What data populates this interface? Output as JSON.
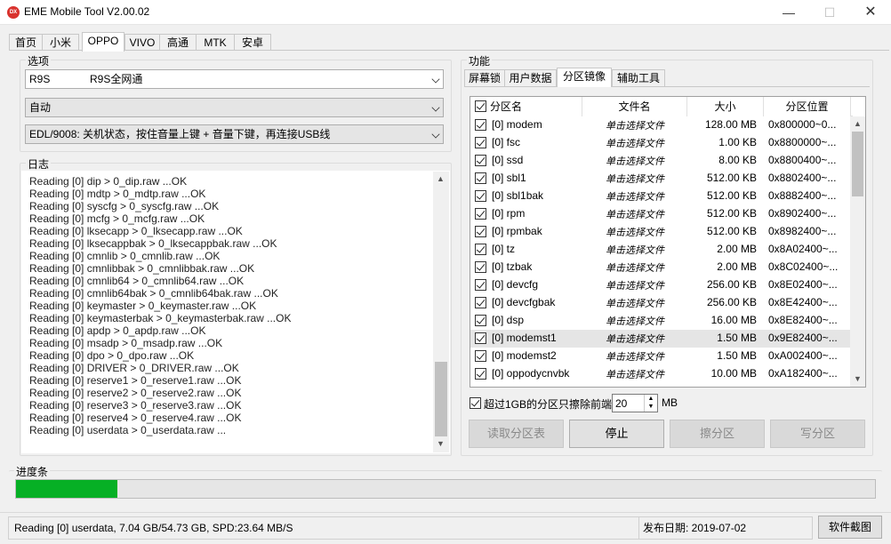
{
  "window": {
    "title": "EME Mobile Tool V2.00.02",
    "icon_text": "DX"
  },
  "top_tabs": [
    "首页",
    "小米",
    "OPPO",
    "VIVO",
    "高通",
    "MTK",
    "安卓"
  ],
  "options": {
    "label": "选项",
    "model": "R9S",
    "model_desc": "R9S全网通",
    "mode": "自动",
    "edl_hint": "EDL/9008: 关机状态，按住音量上键 + 音量下键，再连接USB线"
  },
  "log": {
    "label": "日志",
    "lines": [
      "Reading [0] dip > 0_dip.raw ...OK",
      "Reading [0] mdtp > 0_mdtp.raw ...OK",
      "Reading [0] syscfg > 0_syscfg.raw ...OK",
      "Reading [0] mcfg > 0_mcfg.raw ...OK",
      "Reading [0] lksecapp > 0_lksecapp.raw ...OK",
      "Reading [0] lksecappbak > 0_lksecappbak.raw ...OK",
      "Reading [0] cmnlib > 0_cmnlib.raw ...OK",
      "Reading [0] cmnlibbak > 0_cmnlibbak.raw ...OK",
      "Reading [0] cmnlib64 > 0_cmnlib64.raw ...OK",
      "Reading [0] cmnlib64bak > 0_cmnlib64bak.raw ...OK",
      "Reading [0] keymaster > 0_keymaster.raw ...OK",
      "Reading [0] keymasterbak > 0_keymasterbak.raw ...OK",
      "Reading [0] apdp > 0_apdp.raw ...OK",
      "Reading [0] msadp > 0_msadp.raw ...OK",
      "Reading [0] dpo > 0_dpo.raw ...OK",
      "Reading [0] DRIVER > 0_DRIVER.raw ...OK",
      "Reading [0] reserve1 > 0_reserve1.raw ...OK",
      "Reading [0] reserve2 > 0_reserve2.raw ...OK",
      "Reading [0] reserve3 > 0_reserve3.raw ...OK",
      "Reading [0] reserve4 > 0_reserve4.raw ...OK",
      "Reading [0] userdata > 0_userdata.raw ..."
    ]
  },
  "function": {
    "label": "功能",
    "tabs": [
      "屏幕锁",
      "用户数据",
      "分区镜像",
      "辅助工具"
    ],
    "table": {
      "headers": [
        "分区名",
        "文件名",
        "大小",
        "分区位置"
      ],
      "rows": [
        {
          "name": "[0] modem",
          "file": "单击选择文件",
          "size": "128.00 MB",
          "pos": "0x800000~0..."
        },
        {
          "name": "[0] fsc",
          "file": "单击选择文件",
          "size": "1.00 KB",
          "pos": "0x8800000~..."
        },
        {
          "name": "[0] ssd",
          "file": "单击选择文件",
          "size": "8.00 KB",
          "pos": "0x8800400~..."
        },
        {
          "name": "[0] sbl1",
          "file": "单击选择文件",
          "size": "512.00 KB",
          "pos": "0x8802400~..."
        },
        {
          "name": "[0] sbl1bak",
          "file": "单击选择文件",
          "size": "512.00 KB",
          "pos": "0x8882400~..."
        },
        {
          "name": "[0] rpm",
          "file": "单击选择文件",
          "size": "512.00 KB",
          "pos": "0x8902400~..."
        },
        {
          "name": "[0] rpmbak",
          "file": "单击选择文件",
          "size": "512.00 KB",
          "pos": "0x8982400~..."
        },
        {
          "name": "[0] tz",
          "file": "单击选择文件",
          "size": "2.00 MB",
          "pos": "0x8A02400~..."
        },
        {
          "name": "[0] tzbak",
          "file": "单击选择文件",
          "size": "2.00 MB",
          "pos": "0x8C02400~..."
        },
        {
          "name": "[0] devcfg",
          "file": "单击选择文件",
          "size": "256.00 KB",
          "pos": "0x8E02400~..."
        },
        {
          "name": "[0] devcfgbak",
          "file": "单击选择文件",
          "size": "256.00 KB",
          "pos": "0x8E42400~..."
        },
        {
          "name": "[0] dsp",
          "file": "单击选择文件",
          "size": "16.00 MB",
          "pos": "0x8E82400~..."
        },
        {
          "name": "[0] modemst1",
          "file": "单击选择文件",
          "size": "1.50 MB",
          "pos": "0x9E82400~..."
        },
        {
          "name": "[0] modemst2",
          "file": "单击选择文件",
          "size": "1.50 MB",
          "pos": "0xA002400~..."
        },
        {
          "name": "[0] oppodycnvbk",
          "file": "单击选择文件",
          "size": "10.00 MB",
          "pos": "0xA182400~..."
        }
      ]
    },
    "erase_option": {
      "label": "超过1GB的分区只擦除前端",
      "value": "20",
      "unit": "MB"
    },
    "buttons": [
      "读取分区表",
      "停止",
      "擦分区",
      "写分区"
    ]
  },
  "progress": {
    "label": "进度条",
    "fraction": 0.118
  },
  "status": {
    "message": "Reading [0] userdata, 7.04 GB/54.73 GB, SPD:23.64 MB/S",
    "release_date": "发布日期: 2019-07-02",
    "screenshot_button": "软件截图"
  }
}
